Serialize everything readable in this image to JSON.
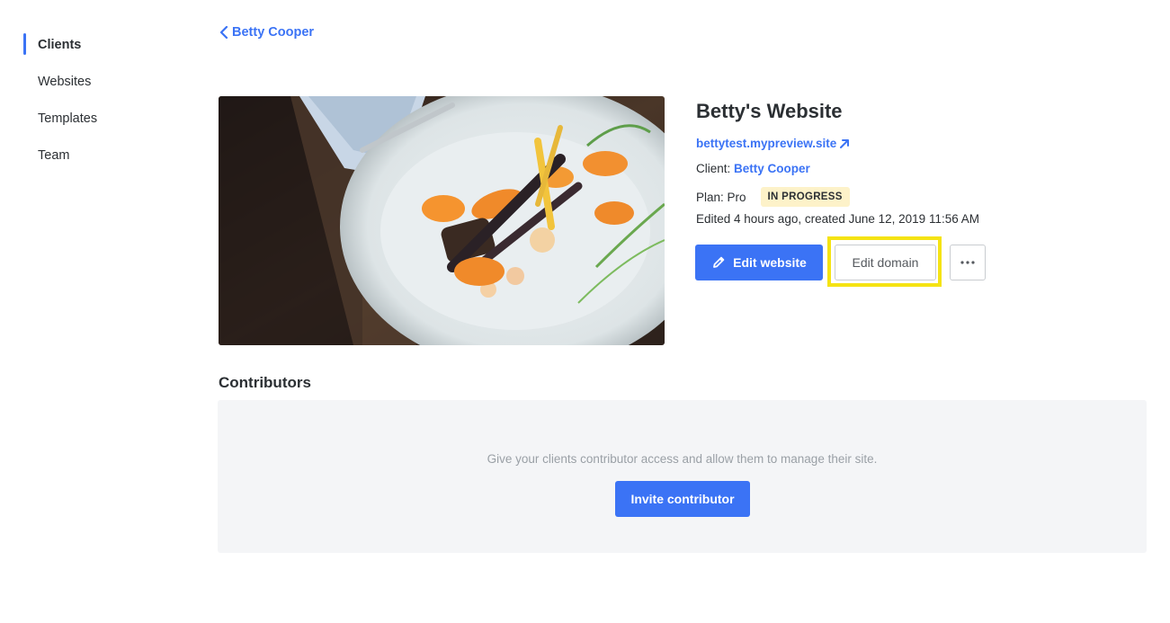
{
  "sidebar": {
    "items": [
      {
        "label": "Clients",
        "active": true
      },
      {
        "label": "Websites",
        "active": false
      },
      {
        "label": "Templates",
        "active": false
      },
      {
        "label": "Team",
        "active": false
      }
    ]
  },
  "breadcrumb": {
    "back_label": "Betty Cooper",
    "icon": "chevron-left-icon"
  },
  "website": {
    "title": "Betty's Website",
    "url": "bettytest.mypreview.site",
    "client_prefix": "Client:",
    "client_name": "Betty Cooper",
    "plan_label": "Plan: Pro",
    "status": "IN PROGRESS",
    "edited": "Edited 4 hours ago, created June 12, 2019 11:56 AM"
  },
  "actions": {
    "edit_website": "Edit website",
    "edit_domain": "Edit domain",
    "more_icon": "more-horizontal-icon"
  },
  "contributors": {
    "heading": "Contributors",
    "empty_text": "Give your clients contributor access and allow them to manage their site.",
    "invite_label": "Invite contributor"
  },
  "colors": {
    "accent": "#3b73f5",
    "badge_bg": "#fdf2c9",
    "highlight": "#f5e313"
  }
}
